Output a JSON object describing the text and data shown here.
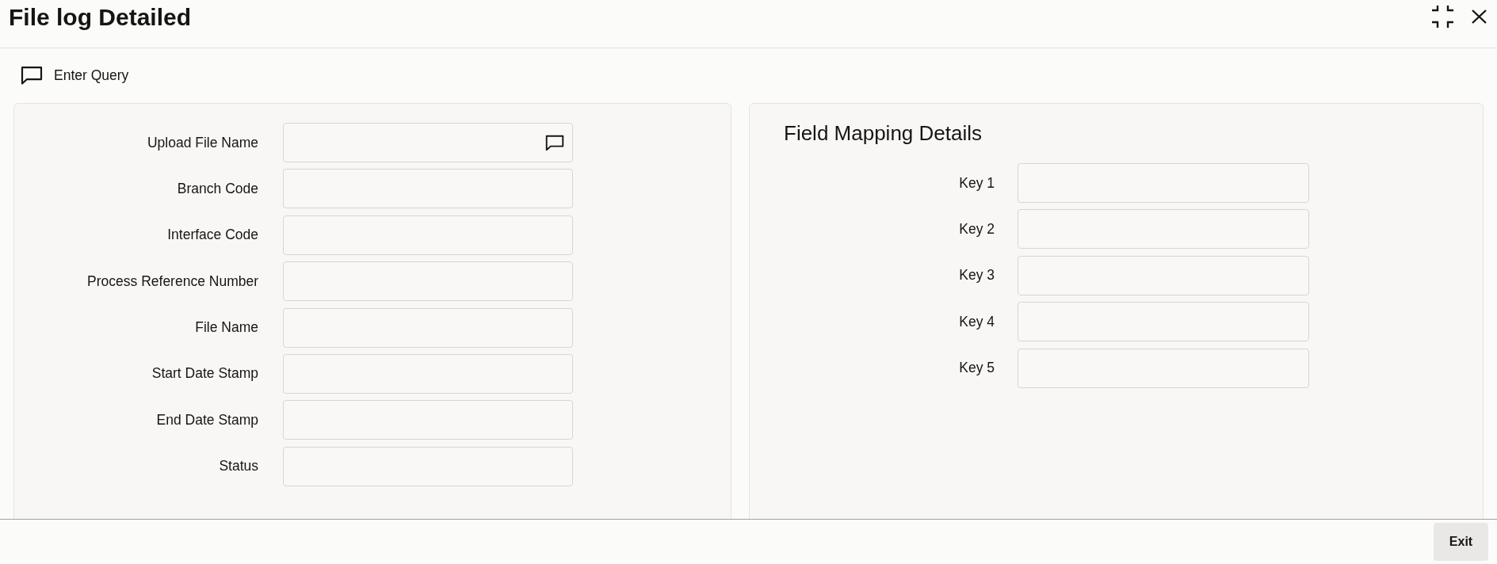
{
  "window": {
    "title": "File log Detailed"
  },
  "toolbar": {
    "buttons": [
      {
        "label": "Enter Query"
      }
    ]
  },
  "upload_form": {
    "fields": [
      {
        "label": "Upload File Name",
        "kind": "lookup"
      },
      {
        "label": "Branch Code",
        "kind": "text"
      },
      {
        "label": "Interface Code",
        "kind": "text"
      },
      {
        "label": "Process Reference Number",
        "kind": "text"
      },
      {
        "label": "File Name",
        "kind": "text"
      },
      {
        "label": "Start Date Stamp",
        "kind": "text"
      },
      {
        "label": "End Date Stamp",
        "kind": "text"
      },
      {
        "label": "Status",
        "kind": "text"
      }
    ]
  },
  "field_mapping": {
    "title": "Field Mapping Details",
    "fields": [
      {
        "label": "Key 1"
      },
      {
        "label": "Key 2"
      },
      {
        "label": "Key 3"
      },
      {
        "label": "Key 4"
      },
      {
        "label": "Key 5"
      }
    ]
  },
  "footer": {
    "buttons": [
      "Exit"
    ]
  }
}
